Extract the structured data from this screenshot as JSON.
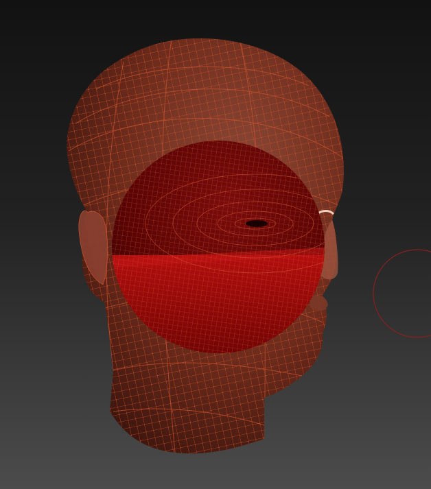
{
  "viewport": {
    "background_top": "#121212",
    "background_bottom": "#4c4c4c"
  },
  "head_model": {
    "skin_color": "#6e2c1c",
    "wireframe_color": "#d0552e"
  },
  "sphere_model": {
    "color_dark": "#5a0404",
    "color_bright": "#b40e0e"
  },
  "brush_cursor": {
    "icon": "brush-circle-icon",
    "color": "#8a2020"
  }
}
